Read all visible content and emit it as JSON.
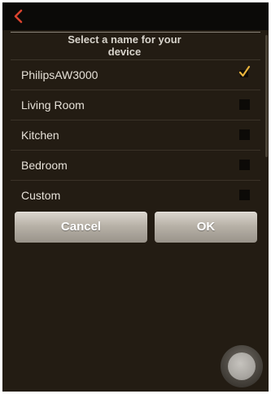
{
  "colors": {
    "accent": "#d9432f",
    "background": "#231c13",
    "topbar": "#0b0a08"
  },
  "topbar": {
    "back_icon": "chevron-left-icon"
  },
  "dialog": {
    "title": "Select a name for your device",
    "options": [
      {
        "label": "PhilipsAW3000",
        "checked": true
      },
      {
        "label": "Living Room",
        "checked": false
      },
      {
        "label": "Kitchen",
        "checked": false
      },
      {
        "label": "Bedroom",
        "checked": false
      },
      {
        "label": "Custom",
        "checked": false
      }
    ],
    "cancel_label": "Cancel",
    "ok_label": "OK"
  },
  "floating": {
    "icon": "assistive-touch-icon"
  }
}
